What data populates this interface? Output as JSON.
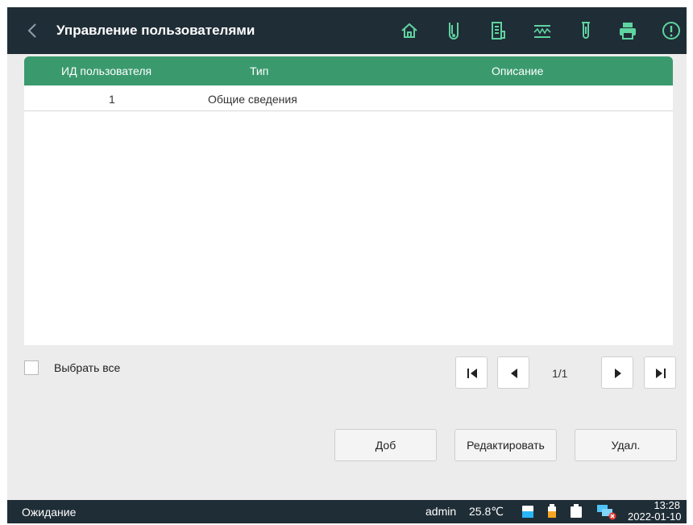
{
  "header": {
    "title": "Управление пользователями"
  },
  "toolbar": {
    "icons": [
      "home-icon",
      "sample-tube-icon",
      "reagent-icon",
      "waveform-icon",
      "test-tube-icon",
      "printer-icon",
      "alert-icon"
    ]
  },
  "table": {
    "columns": [
      "ИД пользователя",
      "Тип",
      "Описание"
    ],
    "rows": [
      {
        "id": "1",
        "type": "Общие сведения",
        "description": ""
      }
    ]
  },
  "select_all": {
    "label": "Выбрать все",
    "checked": false
  },
  "pagination": {
    "page_info": "1/1"
  },
  "actions": {
    "add": "Доб",
    "edit": "Редактировать",
    "delete": "Удал."
  },
  "status_bar": {
    "status": "Ожидание",
    "user": "admin",
    "temperature": "25.8℃",
    "time": "13:28",
    "date": "2022-01-10"
  },
  "colors": {
    "header_bg": "#1f2d36",
    "table_header": "#3a9a6e",
    "icon_accent": "#5fd3a0"
  }
}
